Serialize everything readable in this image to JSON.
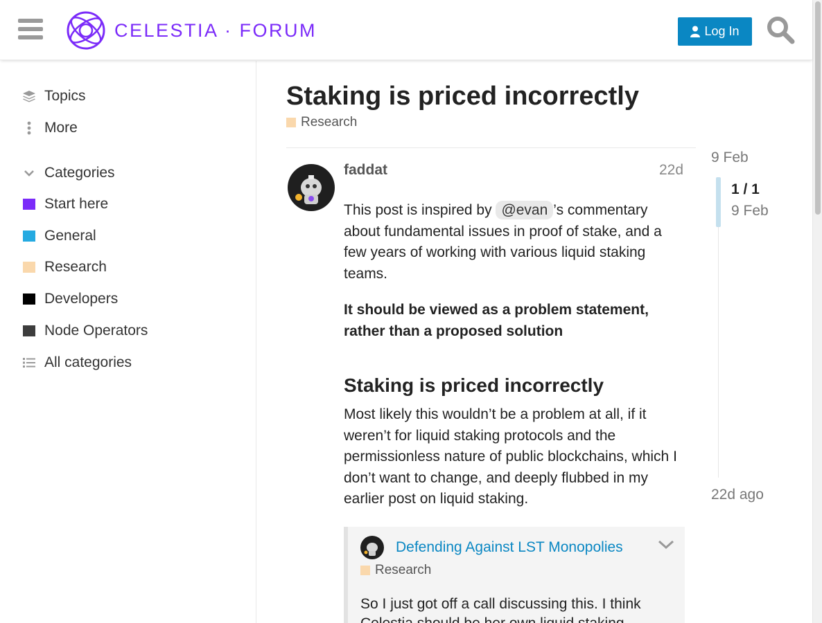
{
  "header": {
    "logo_text": "CELESTIA · FORUM",
    "login_label": "Log In",
    "brand_color": "#7b2bf9",
    "button_color": "#0a87c3"
  },
  "sidebar": {
    "nav": [
      {
        "label": "Topics",
        "icon": "layers-icon"
      },
      {
        "label": "More",
        "icon": "ellipsis-vertical-icon"
      }
    ],
    "categories_label": "Categories",
    "categories": [
      {
        "label": "Start here",
        "color": "#7b2bf9"
      },
      {
        "label": "General",
        "color": "#25aae1"
      },
      {
        "label": "Research",
        "color": "#fad8ac"
      },
      {
        "label": "Developers",
        "color": "#000000"
      },
      {
        "label": "Node Operators",
        "color": "#3d3d3d"
      }
    ],
    "all_categories_label": "All categories"
  },
  "topic": {
    "title": "Staking is priced incorrectly",
    "category": "Research",
    "category_color": "#fad8ac"
  },
  "post": {
    "username": "faddat",
    "date": "22d",
    "p1_before": "This post is inspired by ",
    "mention": "@evan",
    "p1_after": "’s commentary about fundamental issues in proof of stake, and a few years of working with various liquid staking teams.",
    "p2": "It should be viewed as a problem statement, rather than a proposed solution",
    "heading": "Staking is priced incorrectly",
    "p3": "Most likely this wouldn’t be a problem at all, if it weren’t for liquid staking protocols and the permissionless nature of public blockchains, which I don’t want to change, and deeply flubbed in my earlier post on liquid staking."
  },
  "quote": {
    "title": "Defending Against LST Monopolies",
    "category": "Research",
    "text": "So I just got off a call discussing this. I think Celestia should be her own liquid staking"
  },
  "timeline": {
    "top_date": "9 Feb",
    "count": "1 / 1",
    "current_date": "9 Feb",
    "bottom_label": "22d ago"
  }
}
